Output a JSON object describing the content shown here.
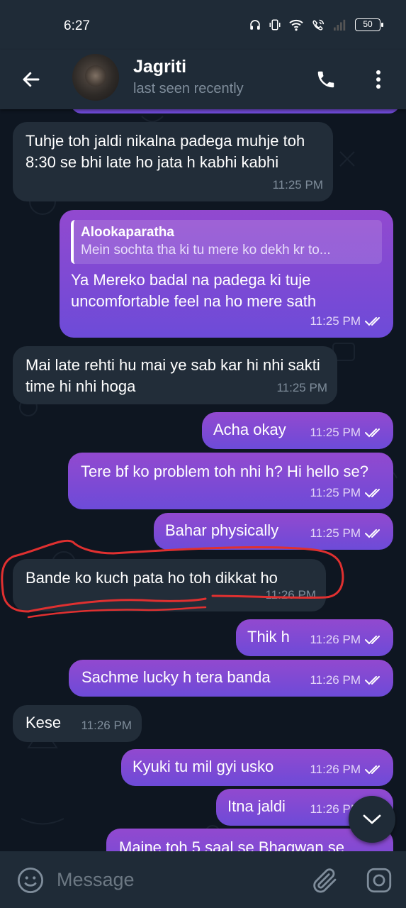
{
  "status_bar": {
    "time": "6:27",
    "battery": "50",
    "icons": [
      "headphones-icon",
      "vibrate-icon",
      "wifi-icon",
      "wifi-calling-icon",
      "signal-icon",
      "battery-icon"
    ]
  },
  "header": {
    "contact_name": "Jagriti",
    "status": "last seen recently",
    "icons": [
      "back-arrow-icon",
      "avatar",
      "phone-icon",
      "more-vert-icon"
    ]
  },
  "messages": [
    {
      "direction": "in",
      "text": "Tuhje toh jaldi nikalna padega muhje toh 8:30 se bhi late ho jata h kabhi kabhi",
      "time": "11:25 PM"
    },
    {
      "direction": "out",
      "reply_to": {
        "name": "Alookaparatha",
        "text": "Mein sochta tha ki tu mere ko dekh kr to..."
      },
      "text": "Ya Mereko badal na padega ki tuje uncomfortable feel na ho mere sath",
      "time": "11:25 PM",
      "read": true
    },
    {
      "direction": "in",
      "text": "Mai late rehti hu mai ye sab kar hi nhi sakti time hi nhi hoga",
      "time": "11:25 PM"
    },
    {
      "direction": "out",
      "text": "Acha okay",
      "time": "11:25 PM",
      "read": true
    },
    {
      "direction": "out",
      "text": "Tere bf ko problem toh nhi h? Hi hello se?",
      "time": "11:25 PM",
      "read": true
    },
    {
      "direction": "out",
      "text": "Bahar physically",
      "time": "11:25 PM",
      "read": true
    },
    {
      "direction": "in",
      "text": "Bande ko kuch pata ho toh dikkat ho",
      "time": "11:26 PM"
    },
    {
      "direction": "out",
      "text": "Thik h",
      "time": "11:26 PM",
      "read": true
    },
    {
      "direction": "out",
      "text": "Sachme lucky h tera banda",
      "time": "11:26 PM",
      "read": true
    },
    {
      "direction": "in",
      "text": "Kese",
      "time": "11:26 PM"
    },
    {
      "direction": "out",
      "text": "Kyuki tu mil gyi usko",
      "time": "11:26 PM",
      "read": true
    },
    {
      "direction": "out",
      "text": "Itna jaldi",
      "time": "11:26 PM",
      "read": true
    },
    {
      "direction": "out",
      "text": "Maine toh 5 saal se Bhagwan se",
      "time": "",
      "read": false
    }
  ],
  "input": {
    "placeholder": "Message",
    "icons": [
      "emoji-icon",
      "attach-icon",
      "camera-icon"
    ]
  },
  "scroll_down_icon": "chevron-down-icon",
  "colors": {
    "background": "#0e1621",
    "bar": "#1f2b37",
    "incoming_bubble": "#222d39",
    "outgoing_bubble_top": "#9249cf",
    "outgoing_bubble_bottom": "#6d4bd8",
    "annotation": "#e03030"
  }
}
